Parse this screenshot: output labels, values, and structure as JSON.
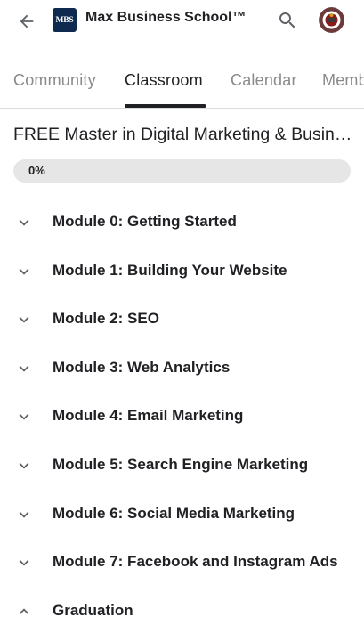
{
  "header": {
    "title": "Max Business School™",
    "logo_text": "MBS",
    "back_icon": "arrow-left-icon",
    "search_icon": "search-icon",
    "avatar_icon": "avatar"
  },
  "tabs": [
    {
      "label": "Community",
      "active": false
    },
    {
      "label": "Classroom",
      "active": true
    },
    {
      "label": "Calendar",
      "active": false
    },
    {
      "label": "Members",
      "active": false
    }
  ],
  "course": {
    "title": "FREE Master in Digital Marketing & Business",
    "progress_label": "0%",
    "progress": 0
  },
  "modules": [
    {
      "label": "Module 0: Getting Started",
      "icon": "chevron-down-icon"
    },
    {
      "label": "Module 1: Building Your Website",
      "icon": "chevron-down-icon"
    },
    {
      "label": "Module 2: SEO",
      "icon": "chevron-down-icon"
    },
    {
      "label": "Module 3: Web Analytics",
      "icon": "chevron-down-icon"
    },
    {
      "label": "Module 4: Email Marketing",
      "icon": "chevron-down-icon"
    },
    {
      "label": "Module 5: Search Engine Marketing",
      "icon": "chevron-down-icon"
    },
    {
      "label": "Module 6: Social Media Marketing",
      "icon": "chevron-down-icon"
    },
    {
      "label": "Module 7: Facebook and Instagram Ads",
      "icon": "chevron-down-icon"
    },
    {
      "label": "Graduation",
      "icon": "chevron-up-icon"
    }
  ],
  "colors": {
    "logo_bg": "#0f2a4f",
    "text": "#202124",
    "muted": "#8a8a8a",
    "progress_track": "#e6e6e6"
  }
}
